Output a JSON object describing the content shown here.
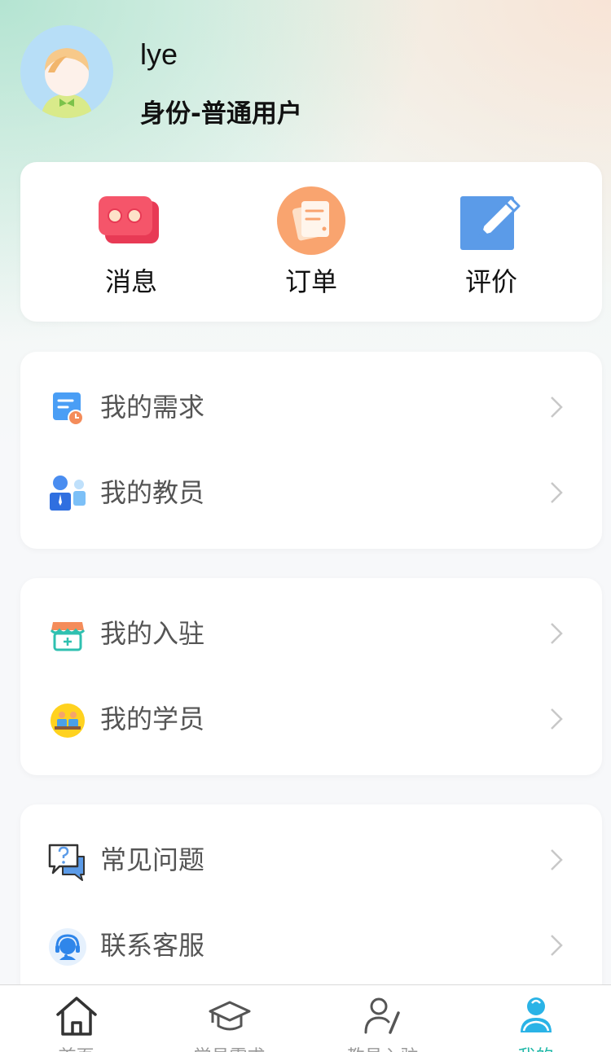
{
  "profile": {
    "username": "lye",
    "identity": "身份-普通用户"
  },
  "quick_actions": [
    {
      "label": "消息",
      "icon": "message-icon"
    },
    {
      "label": "订单",
      "icon": "order-icon"
    },
    {
      "label": "评价",
      "icon": "review-icon"
    }
  ],
  "menu_groups": [
    {
      "items": [
        {
          "label": "我的需求",
          "icon": "demand-icon"
        },
        {
          "label": "我的教员",
          "icon": "teacher-icon"
        }
      ]
    },
    {
      "items": [
        {
          "label": "我的入驻",
          "icon": "store-icon"
        },
        {
          "label": "我的学员",
          "icon": "students-icon"
        }
      ]
    },
    {
      "items": [
        {
          "label": "常见问题",
          "icon": "faq-icon"
        },
        {
          "label": "联系客服",
          "icon": "customer-service-icon"
        }
      ]
    }
  ],
  "tabbar": {
    "active_index": 3,
    "items": [
      {
        "label": "首页",
        "icon": "home-icon"
      },
      {
        "label": "学员需求",
        "icon": "graduation-cap-icon"
      },
      {
        "label": "教员入驻",
        "icon": "teacher-join-icon"
      },
      {
        "label": "我的",
        "icon": "profile-icon"
      }
    ]
  },
  "colors": {
    "accent": "#1fb8a8",
    "message_red": "#f5556a",
    "order_orange": "#f9a46f",
    "review_blue": "#5b9be8"
  }
}
